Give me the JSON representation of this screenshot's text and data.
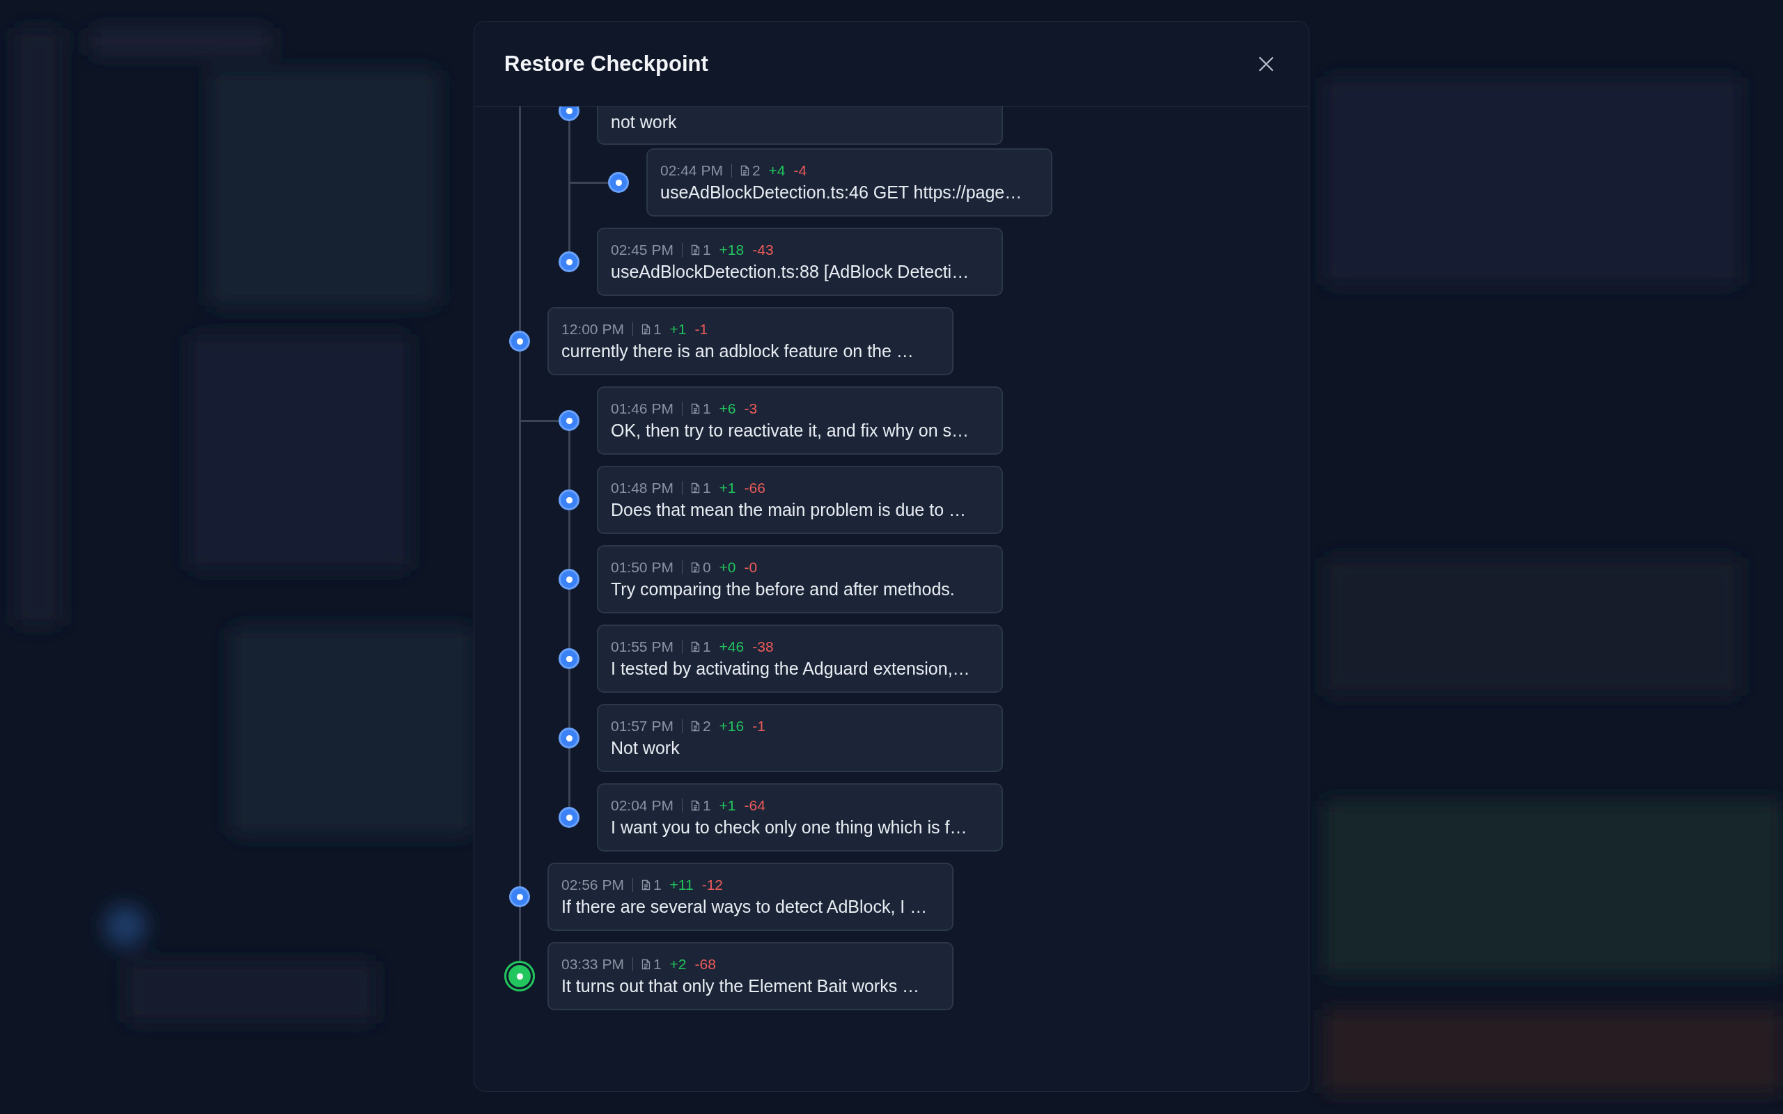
{
  "dialog": {
    "title": "Restore Checkpoint"
  },
  "timeline": [
    {
      "children": [
        {
          "message": "not work",
          "kind": "checkpoint",
          "children": [
            {
              "time": "02:44 PM",
              "files": "2",
              "added": "+4",
              "removed": "-4",
              "message": "useAdBlockDetection.ts:46 GET https://page…",
              "kind": "checkpoint"
            }
          ]
        },
        {
          "time": "02:45 PM",
          "files": "1",
          "added": "+18",
          "removed": "-43",
          "message": "useAdBlockDetection.ts:88 [AdBlock Detecti…",
          "kind": "checkpoint"
        }
      ]
    },
    {
      "time": "12:00 PM",
      "files": "1",
      "added": "+1",
      "removed": "-1",
      "message": "currently there is an adblock feature on the …",
      "kind": "checkpoint",
      "children": [
        {
          "time": "01:46 PM",
          "files": "1",
          "added": "+6",
          "removed": "-3",
          "message": "OK, then try to reactivate it, and fix why on s…",
          "kind": "checkpoint"
        },
        {
          "time": "01:48 PM",
          "files": "1",
          "added": "+1",
          "removed": "-66",
          "message": "Does that mean the main problem is due to …",
          "kind": "checkpoint"
        },
        {
          "time": "01:50 PM",
          "files": "0",
          "added": "+0",
          "removed": "-0",
          "message": "Try comparing the before and after methods.",
          "kind": "checkpoint"
        },
        {
          "time": "01:55 PM",
          "files": "1",
          "added": "+46",
          "removed": "-38",
          "message": "I tested by activating the Adguard extension,…",
          "kind": "checkpoint"
        },
        {
          "time": "01:57 PM",
          "files": "2",
          "added": "+16",
          "removed": "-1",
          "message": "Not work",
          "kind": "checkpoint"
        },
        {
          "time": "02:04 PM",
          "files": "1",
          "added": "+1",
          "removed": "-64",
          "message": "I want you to check only one thing which is f…",
          "kind": "checkpoint"
        }
      ]
    },
    {
      "time": "02:56 PM",
      "files": "1",
      "added": "+11",
      "removed": "-12",
      "message": "If there are several ways to detect AdBlock, I …",
      "kind": "checkpoint"
    },
    {
      "time": "03:33 PM",
      "files": "1",
      "added": "+2",
      "removed": "-68",
      "message": "It turns out that only the Element Bait works …",
      "kind": "current"
    }
  ]
}
